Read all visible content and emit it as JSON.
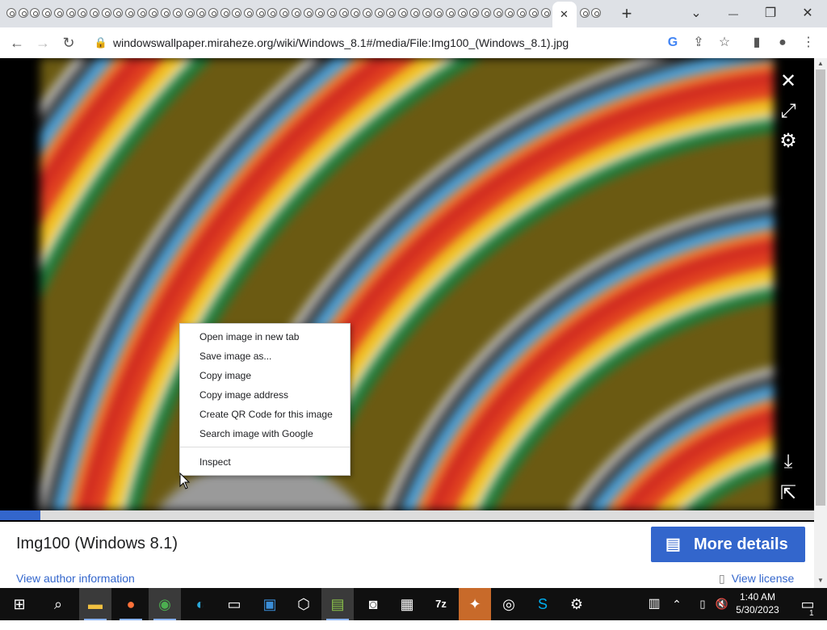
{
  "browser": {
    "tab_favicon_count": 46,
    "active_tab_close": "✕",
    "new_tab": "+",
    "window_controls": {
      "dropdown": "⌄",
      "minimize": "—",
      "restore": "❐",
      "close": "✕"
    },
    "url": "windowswallpaper.miraheze.org/wiki/Windows_8.1#/media/File:Img100_(Windows_8.1).jpg",
    "icons": [
      "back-icon",
      "forward-icon",
      "reload-icon",
      "lock-icon",
      "google-icon",
      "share-icon",
      "star-icon",
      "sidepanel-icon",
      "profile-icon",
      "menu-icon"
    ]
  },
  "viewer": {
    "progress_fraction": 0.05,
    "icons": [
      "close-icon",
      "fullscreen-icon",
      "settings-icon",
      "download-icon",
      "share-icon"
    ]
  },
  "info": {
    "title": "Img100 (Windows 8.1)",
    "more_details": "More details",
    "author_link": "View author information",
    "license_link": "View license"
  },
  "context_menu": {
    "items": [
      "Open image in new tab",
      "Save image as...",
      "Copy image",
      "Copy image address",
      "Create QR Code for this image",
      "Search image with Google",
      "Inspect"
    ]
  },
  "taskbar": {
    "apps": [
      "start-icon",
      "search-icon",
      "file-explorer-icon",
      "firefox-icon",
      "chrome-icon",
      "edge-icon",
      "terminal-icon",
      "photos-icon",
      "3d-viewer-icon",
      "notepad-icon",
      "camera-icon",
      "calendar-icon",
      "7zip-icon",
      "app-icon",
      "media-icon",
      "skype-icon",
      "settings-icon"
    ],
    "time": "1:40 AM",
    "date": "5/30/2023",
    "notification_count": "1"
  }
}
